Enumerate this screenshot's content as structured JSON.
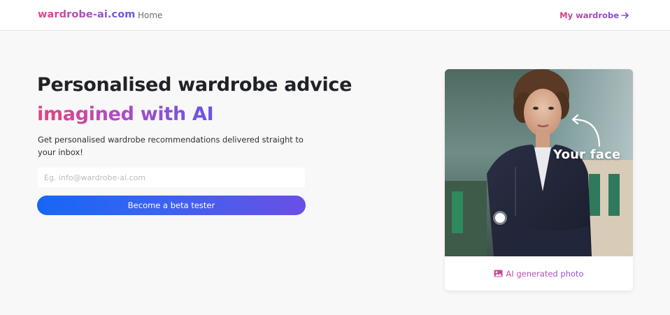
{
  "header": {
    "brand": "wardrobe-ai.com",
    "nav_home": "Home",
    "my_wardrobe": "My wardrobe",
    "my_wardrobe_icon": "arrow-right-icon"
  },
  "hero": {
    "title": "Personalised wardrobe advice",
    "subtitle": "imagined with AI",
    "description": "Get personalised wardrobe recommendations delivered straight to your inbox!",
    "email_placeholder": "Eg. info@wardrobe-ai.com",
    "email_value": "",
    "cta_label": "Become a beta tester"
  },
  "card": {
    "overlay_label": "Your face",
    "caption": "AI generated photo",
    "caption_icon": "image-icon",
    "slider_icon": "slider-handle"
  },
  "colors": {
    "gradient_pink": "#e8437d",
    "gradient_purple": "#9b4fd0",
    "gradient_blue": "#1766f5",
    "page_background": "#f8f8f8"
  }
}
